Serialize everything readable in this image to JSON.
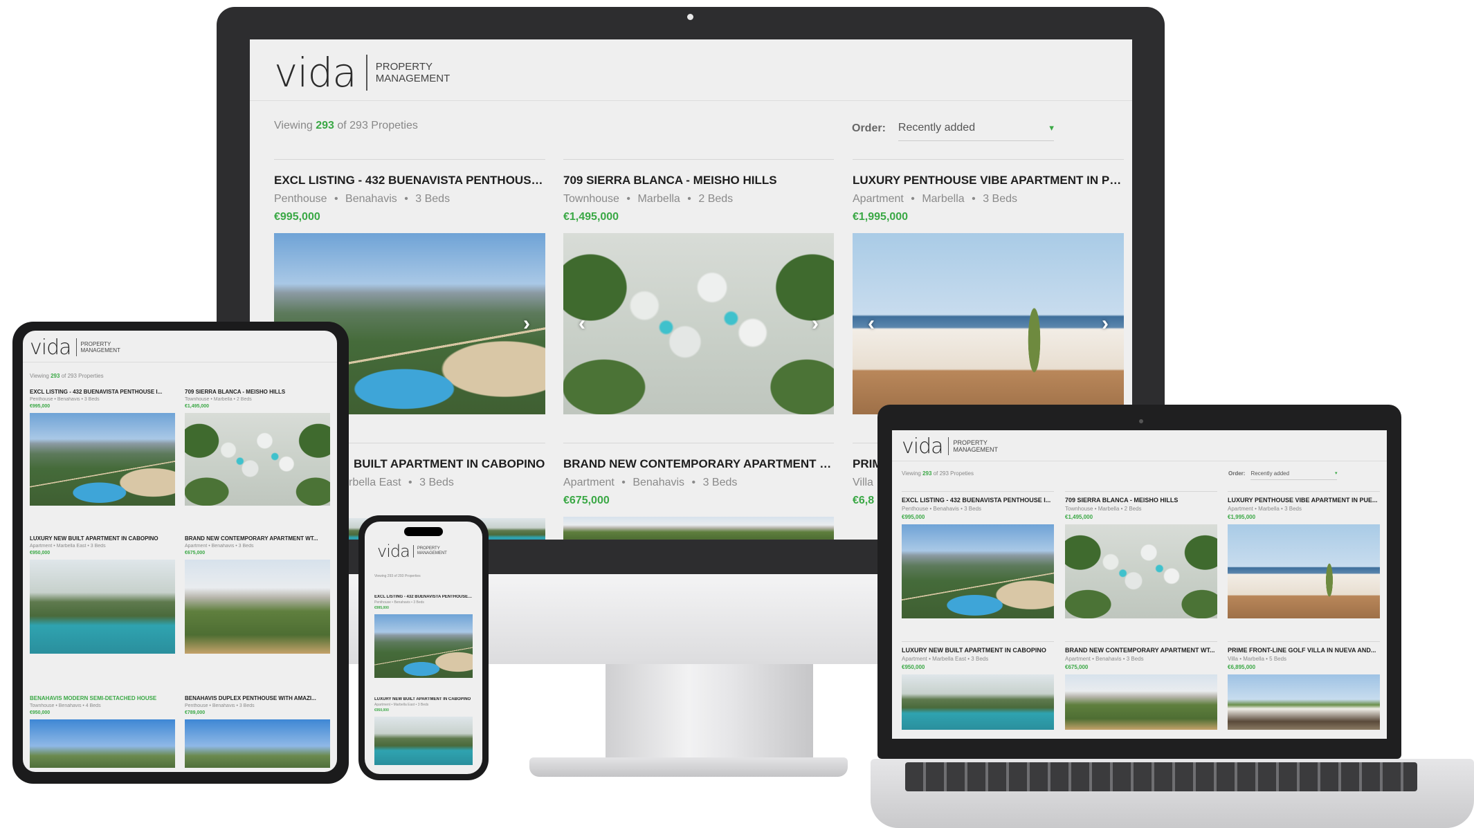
{
  "brand": {
    "wordmark": "vida",
    "sub_line1": "PROPERTY",
    "sub_line2": "MANAGEMENT"
  },
  "colors": {
    "accent": "#3aa845",
    "page_bg": "#efefef",
    "title": "#1e1e1e",
    "meta": "#8a8a8a"
  },
  "desktop": {
    "count_prefix": "Viewing",
    "count_shown": "293",
    "count_suffix": "of 293 Propeties",
    "order_label": "Order:",
    "order_value": "Recently added",
    "listings": [
      {
        "title": "EXCL LISTING - 432 BUENAVISTA PENTHOUSE I...",
        "type": "Penthouse",
        "area": "Benahavis",
        "beds": "3 Beds",
        "price": "€995,000"
      },
      {
        "title": "709 SIERRA BLANCA - MEISHO HILLS",
        "type": "Townhouse",
        "area": "Marbella",
        "beds": "2 Beds",
        "price": "€1,495,000"
      },
      {
        "title": "LUXURY PENTHOUSE VIBE APARTMENT IN PUE...",
        "type": "Apartment",
        "area": "Marbella",
        "beds": "3 Beds",
        "price": "€1,995,000"
      },
      {
        "title": "BUILT APARTMENT IN CABOPINO",
        "type": "",
        "area": "rbella East",
        "beds": "3 Beds",
        "price": ""
      },
      {
        "title": "BRAND NEW CONTEMPORARY APARTMENT WT...",
        "type": "Apartment",
        "area": "Benahavis",
        "beds": "3 Beds",
        "price": "€675,000"
      },
      {
        "title": "PRIM",
        "type": "Villa",
        "area": "",
        "beds": "",
        "price": "€6,8"
      }
    ]
  },
  "tablet": {
    "count_prefix": "Viewing",
    "count_shown": "293",
    "count_suffix": "of 293 Properties",
    "listings": [
      {
        "title": "EXCL LISTING - 432 BUENAVISTA PENTHOUSE I...",
        "meta": "Penthouse • Benahavis • 3 Beds",
        "price": "€995,000"
      },
      {
        "title": "709 SIERRA BLANCA - MEISHO HILLS",
        "meta": "Townhouse • Marbella • 2 Beds",
        "price": "€1,495,000"
      },
      {
        "title": "LUXURY NEW BUILT APARTMENT IN CABOPINO",
        "meta": "Apartment • Marbella East • 3 Beds",
        "price": "€950,000"
      },
      {
        "title": "BRAND NEW CONTEMPORARY APARTMENT WT...",
        "meta": "Apartment • Benahavis • 3 Beds",
        "price": "€675,000"
      },
      {
        "title": "BENAHAVIS MODERN SEMI-DETACHED HOUSE",
        "meta": "Townhouse • Benahavis • 4 Beds",
        "price": "€950,000"
      },
      {
        "title": "BENAHAVIS DUPLEX PENTHOUSE WITH AMAZI...",
        "meta": "Penthouse • Benahavis • 3 Beds",
        "price": "€789,000"
      }
    ]
  },
  "phone": {
    "count_text": "Viewing 293 of 293 Properties",
    "listings": [
      {
        "title": "EXCL LISTING - 432 BUENAVISTA PENTHOUSE I...",
        "meta": "Penthouse • Benahavis • 3 Beds",
        "price": "€995,000"
      },
      {
        "title": "LUXURY NEW BUILT APARTMENT IN CABOPINO",
        "meta": "Apartment • Marbella East • 3 Beds",
        "price": "€950,000"
      }
    ]
  },
  "laptop": {
    "count_prefix": "Viewing",
    "count_shown": "293",
    "count_suffix": "of 293 Propeties",
    "order_label": "Order:",
    "order_value": "Recently added",
    "listings": [
      {
        "title": "EXCL LISTING - 432 BUENAVISTA PENTHOUSE I...",
        "meta": "Penthouse • Benahavis • 3 Beds",
        "price": "€995,000"
      },
      {
        "title": "709 SIERRA BLANCA - MEISHO HILLS",
        "meta": "Townhouse • Marbella • 2 Beds",
        "price": "€1,495,000"
      },
      {
        "title": "LUXURY PENTHOUSE VIBE APARTMENT IN PUE...",
        "meta": "Apartment • Marbella • 3 Beds",
        "price": "€1,995,000"
      },
      {
        "title": "LUXURY NEW BUILT APARTMENT IN CABOPINO",
        "meta": "Apartment • Marbella East • 3 Beds",
        "price": "€950,000"
      },
      {
        "title": "BRAND NEW CONTEMPORARY APARTMENT WT...",
        "meta": "Apartment • Benahavis • 3 Beds",
        "price": "€675,000"
      },
      {
        "title": "PRIME FRONT-LINE GOLF VILLA IN NUEVA AND...",
        "meta": "Villa • Marbella • 5 Beds",
        "price": "€6,895,000"
      }
    ]
  },
  "icons": {
    "next": "›",
    "prev": "‹",
    "caret": "▾",
    "dot": "•"
  }
}
